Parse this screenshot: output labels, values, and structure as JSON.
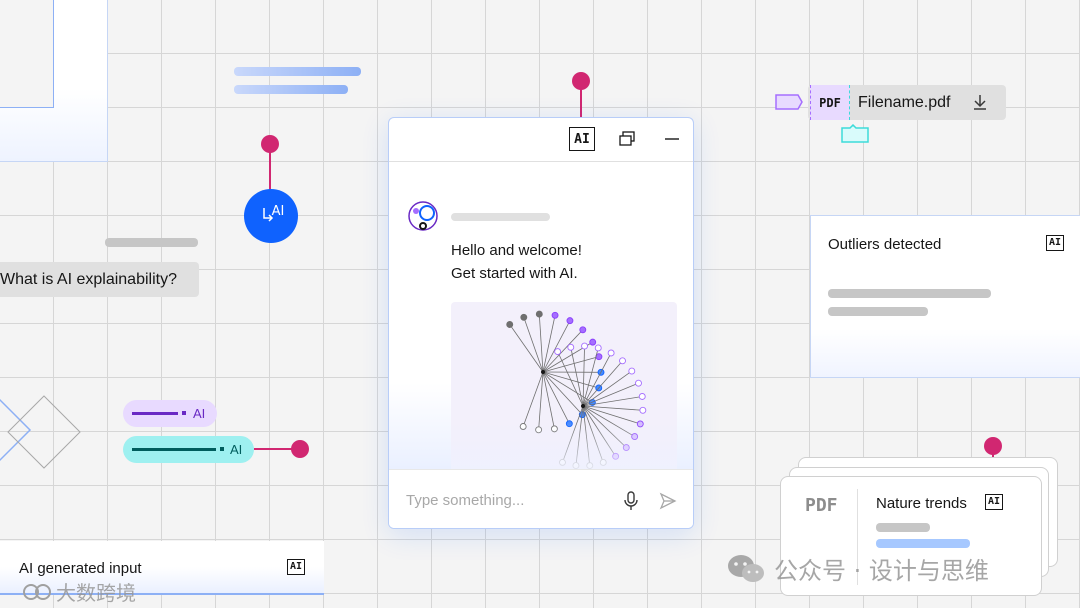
{
  "chat": {
    "header_ai_badge": "AI",
    "greeting_line1": "Hello and welcome!",
    "greeting_line2": "Get started with AI.",
    "input_placeholder": "Type something..."
  },
  "ai_button": {
    "label": "AI"
  },
  "question_bubble": {
    "text": "What is AI explainability?"
  },
  "labels": {
    "purple_tag": "AI",
    "teal_tag": "AI"
  },
  "file_chip": {
    "type": "PDF",
    "name": "Filename.pdf"
  },
  "outliers_card": {
    "title": "Outliers detected",
    "ai_badge": "AI"
  },
  "nature_card": {
    "file_type": "PDF",
    "title": "Nature trends",
    "ai_badge": "AI"
  },
  "generated_input": {
    "label": "AI generated input",
    "ai_badge": "AI"
  },
  "watermarks": {
    "left": "大数跨境",
    "right": "公众号 · 设计与思维"
  },
  "colors": {
    "accent_blue": "#0f62fe",
    "pin_magenta": "#d12771",
    "purple": "#6929c4",
    "teal": "#3ddbd9"
  }
}
